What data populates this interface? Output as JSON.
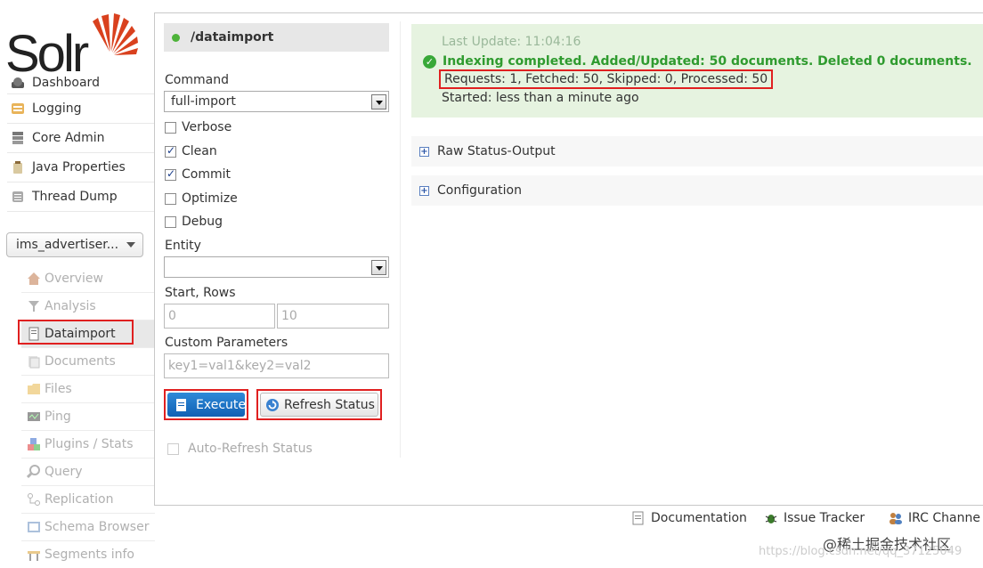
{
  "logo": {
    "word": "Solr"
  },
  "sidebar": {
    "main_items": [
      {
        "label": "Dashboard",
        "icon": "dashboard-icon"
      },
      {
        "label": "Logging",
        "icon": "logging-icon"
      },
      {
        "label": "Core Admin",
        "icon": "core-admin-icon"
      },
      {
        "label": "Java Properties",
        "icon": "java-properties-icon"
      },
      {
        "label": "Thread Dump",
        "icon": "thread-dump-icon"
      }
    ],
    "core_selector": {
      "value": "ims_advertiser..."
    },
    "core_items": [
      {
        "label": "Overview",
        "icon": "overview-icon"
      },
      {
        "label": "Analysis",
        "icon": "analysis-icon"
      },
      {
        "label": "Dataimport",
        "icon": "dataimport-icon",
        "active": true
      },
      {
        "label": "Documents",
        "icon": "documents-icon"
      },
      {
        "label": "Files",
        "icon": "files-icon"
      },
      {
        "label": "Ping",
        "icon": "ping-icon"
      },
      {
        "label": "Plugins / Stats",
        "icon": "plugins-icon"
      },
      {
        "label": "Query",
        "icon": "query-icon"
      },
      {
        "label": "Replication",
        "icon": "replication-icon"
      },
      {
        "label": "Schema Browser",
        "icon": "schema-browser-icon"
      },
      {
        "label": "Segments info",
        "icon": "segments-icon"
      }
    ]
  },
  "form": {
    "handler": "/dataimport",
    "command_label": "Command",
    "command_value": "full-import",
    "options": [
      {
        "label": "Verbose",
        "checked": false
      },
      {
        "label": "Clean",
        "checked": true
      },
      {
        "label": "Commit",
        "checked": true
      },
      {
        "label": "Optimize",
        "checked": false
      },
      {
        "label": "Debug",
        "checked": false
      }
    ],
    "entity_label": "Entity",
    "entity_value": "",
    "start_rows_label": "Start, Rows",
    "start_value": "0",
    "rows_value": "10",
    "custom_label": "Custom Parameters",
    "custom_placeholder": "key1=val1&key2=val2",
    "execute_label": "Execute",
    "refresh_label": "Refresh Status",
    "auto_refresh_label": "Auto-Refresh Status"
  },
  "status": {
    "last_update": "Last Update: 11:04:16",
    "message": "Indexing completed. Added/Updated: 50 documents. Deleted 0 documents.",
    "counts": "Requests: 1, Fetched: 50, Skipped: 0, Processed: 50",
    "started": "Started: less than a minute ago"
  },
  "sections": {
    "raw": "Raw Status-Output",
    "config": "Configuration"
  },
  "footer": {
    "documentation": "Documentation",
    "issue_tracker": "Issue Tracker",
    "irc": "IRC Channe"
  },
  "watermark": {
    "juejin": "@稀土掘金技术社区",
    "url": "https://blog.csdn.net/qq_37125049"
  },
  "colors": {
    "success_green": "#2f9b2f",
    "status_bg": "#e6f3e0",
    "highlight_red": "#e02020",
    "execute_blue": "#1a6fc4"
  }
}
